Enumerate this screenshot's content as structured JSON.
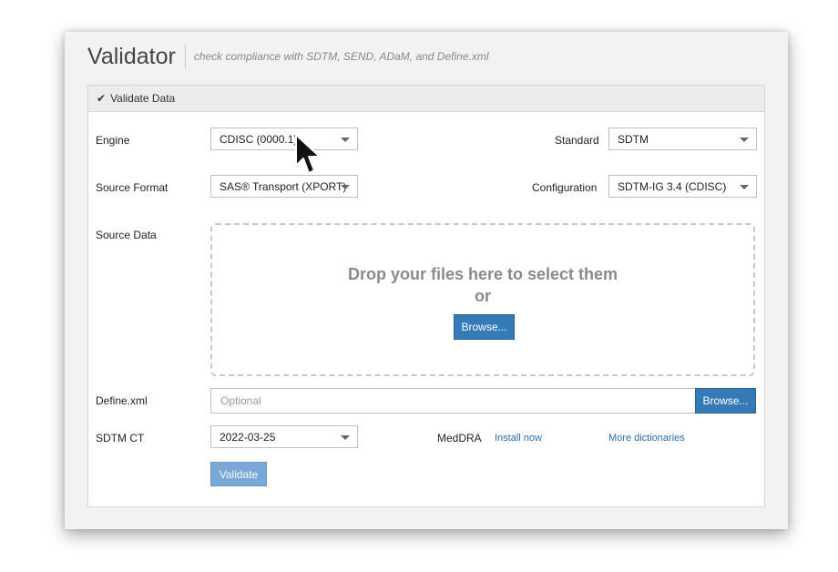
{
  "header": {
    "title": "Validator",
    "subtitle": "check compliance with SDTM, SEND, ADaM, and Define.xml"
  },
  "panel": {
    "heading": "Validate Data"
  },
  "form": {
    "engine": {
      "label": "Engine",
      "value": "CDISC (0000.1)"
    },
    "standard": {
      "label": "Standard",
      "value": "SDTM"
    },
    "source_format": {
      "label": "Source Format",
      "value": "SAS® Transport (XPORT)"
    },
    "configuration": {
      "label": "Configuration",
      "value": "SDTM-IG 3.4 (CDISC)"
    },
    "source_data": {
      "label": "Source Data",
      "drop_line1": "Drop your files here to select them",
      "drop_line2": "or",
      "browse_label": "Browse..."
    },
    "define": {
      "label": "Define.xml",
      "placeholder": "Optional",
      "browse_label": "Browse..."
    },
    "sdtm_ct": {
      "label": "SDTM CT",
      "value": "2022-03-25"
    },
    "meddra": {
      "label": "MedDRA",
      "install_link": "Install now",
      "more_link": "More dictionaries"
    },
    "validate_label": "Validate"
  },
  "icons": {
    "heading_icon": "check-icon",
    "pointer": "mouse-cursor-icon"
  },
  "colors": {
    "primary": "#337ab7",
    "link": "#2a6eb0",
    "disabled_primary": "#7aa8d6"
  }
}
